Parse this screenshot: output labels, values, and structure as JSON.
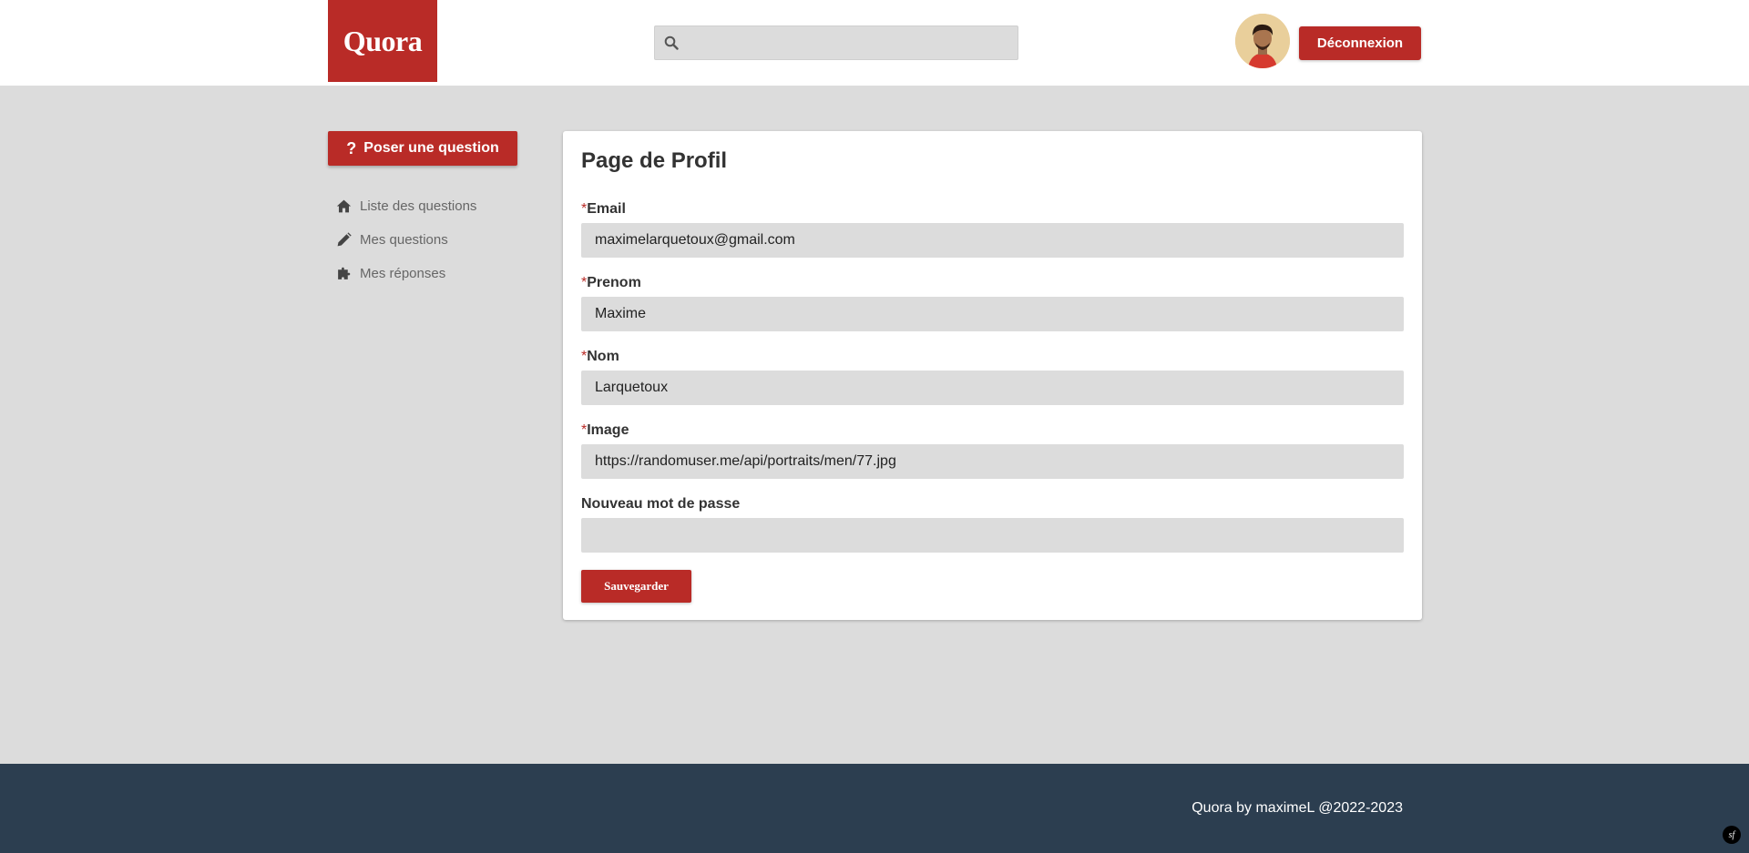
{
  "header": {
    "logo_text": "Quora",
    "search": {
      "value": "",
      "placeholder": ""
    },
    "logout_label": "Déconnexion"
  },
  "sidebar": {
    "ask_label": "Poser une question",
    "ask_icon": "?",
    "items": [
      {
        "label": "Liste des questions",
        "icon": "home-icon"
      },
      {
        "label": "Mes questions",
        "icon": "pencil-icon"
      },
      {
        "label": "Mes réponses",
        "icon": "puzzle-icon"
      }
    ]
  },
  "profile": {
    "title": "Page de Profil",
    "required_marker": "*",
    "fields": [
      {
        "label": "Email",
        "value": "maximelarquetoux@gmail.com",
        "required": true
      },
      {
        "label": "Prenom",
        "value": "Maxime",
        "required": true
      },
      {
        "label": "Nom",
        "value": "Larquetoux",
        "required": true
      },
      {
        "label": "Image",
        "value": "https://randomuser.me/api/portraits/men/77.jpg",
        "required": true
      },
      {
        "label": "Nouveau mot de passe",
        "value": "",
        "required": false
      }
    ],
    "save_label": "Sauvegarder"
  },
  "footer": {
    "text": "Quora by maximeL @2022-2023",
    "badge": "sf"
  },
  "colors": {
    "brand_red": "#b92b27",
    "background": "#dcdcdc",
    "footer_bg": "#2c3e50"
  }
}
